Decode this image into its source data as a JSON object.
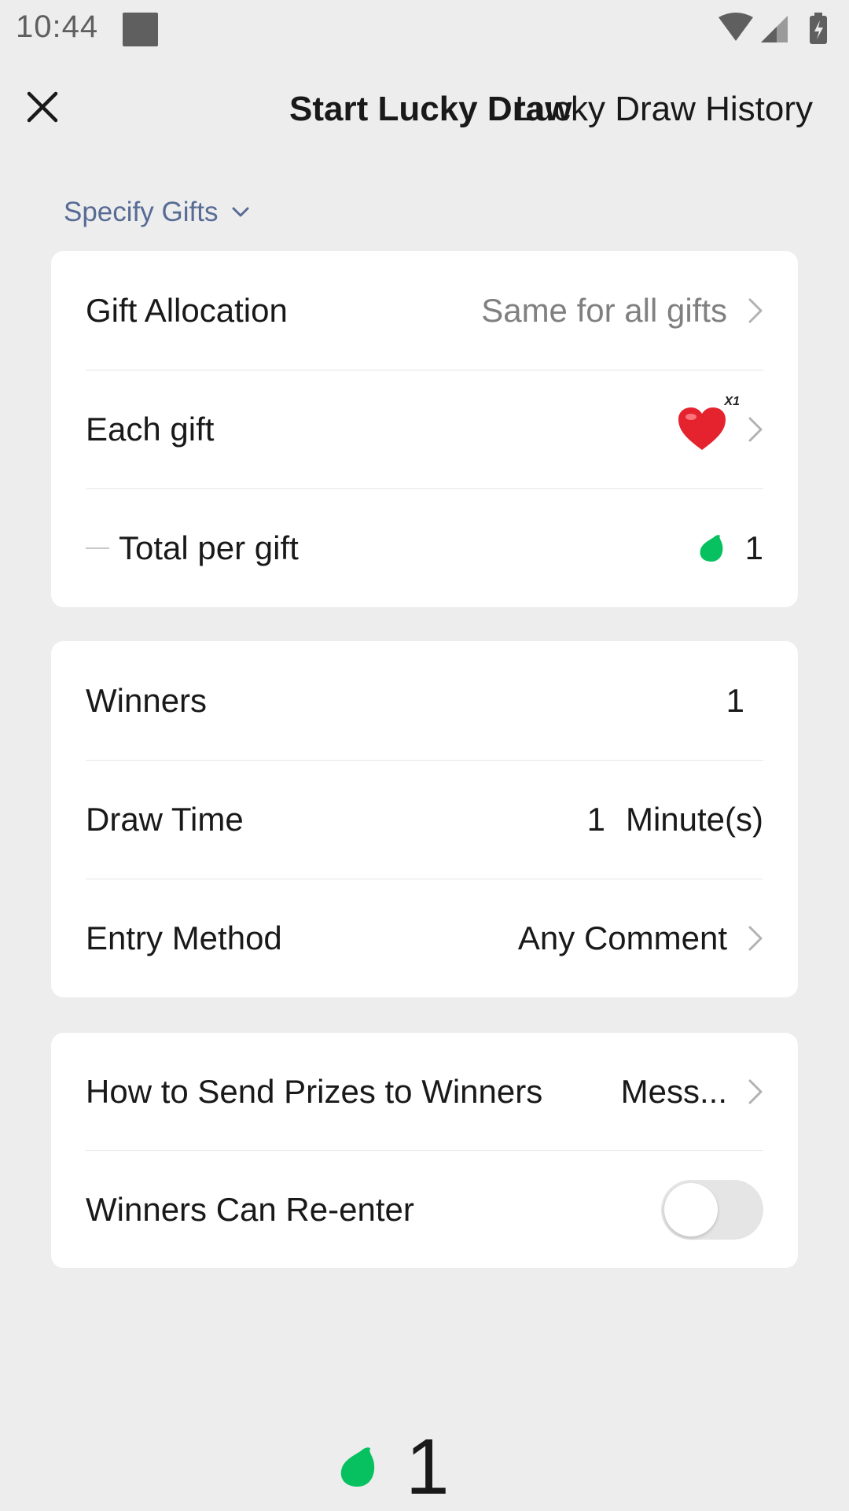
{
  "status": {
    "time": "10:44"
  },
  "header": {
    "title": "Start Lucky Draw",
    "history": "Lucky Draw History"
  },
  "specify_gifts": "Specify Gifts",
  "gift_card": {
    "allocation_label": "Gift Allocation",
    "allocation_value": "Same for all gifts",
    "each_gift_label": "Each gift",
    "each_gift_count": "X1",
    "total_label": "Total per gift",
    "total_value": "1"
  },
  "settings_card": {
    "winners_label": "Winners",
    "winners_value": "1",
    "draw_time_label": "Draw Time",
    "draw_time_value": "1",
    "draw_time_unit": "Minute(s)",
    "entry_label": "Entry Method",
    "entry_value": "Any Comment"
  },
  "prize_card": {
    "send_label": "How to Send Prizes to Winners",
    "send_value": "Mess...",
    "reenter_label": "Winners Can Re-enter",
    "reenter_enabled": false
  },
  "bottom": {
    "total": "1"
  },
  "colors": {
    "background": "#ededed",
    "link": "#576b95",
    "coin_green": "#07c160",
    "heart_red": "#e5232f"
  },
  "icons": [
    "close-icon",
    "chevron-down-icon",
    "chevron-right-icon",
    "heart-gift-icon",
    "coin-icon",
    "wifi-icon",
    "signal-icon",
    "battery-icon"
  ]
}
